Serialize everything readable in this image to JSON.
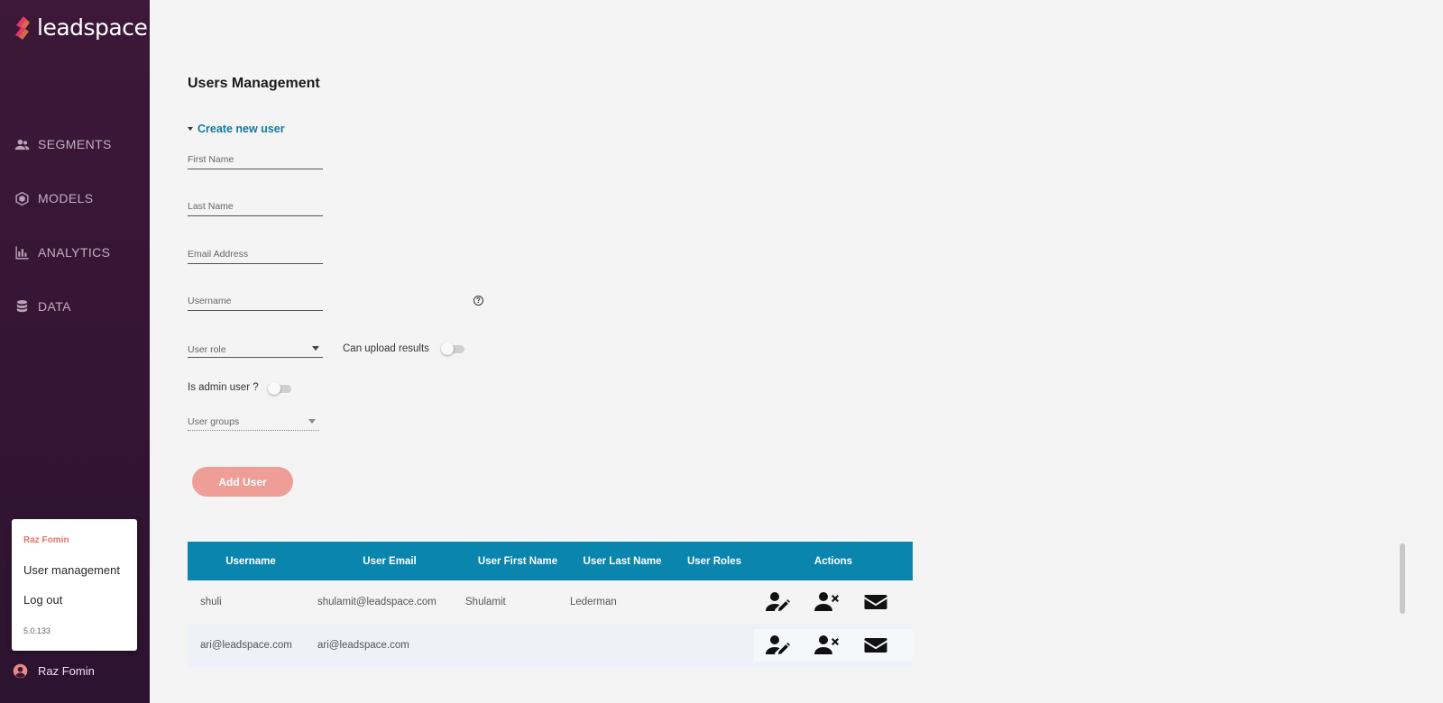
{
  "brand": {
    "name": "leadspace",
    "mark_colors": [
      "#e8346f",
      "#f07a46"
    ]
  },
  "sidebar": {
    "items": [
      {
        "label": "SEGMENTS",
        "icon": "people-icon"
      },
      {
        "label": "MODELS",
        "icon": "cube-icon"
      },
      {
        "label": "ANALYTICS",
        "icon": "bar-chart-icon"
      },
      {
        "label": "DATA",
        "icon": "database-icon"
      }
    ]
  },
  "user_menu": {
    "name": "Raz Fomin",
    "items": [
      "User management",
      "Log out"
    ],
    "version": "5.0.133"
  },
  "footer_user": {
    "name": "Raz Fomin",
    "icon": "account-circle-icon"
  },
  "page": {
    "title": "Users Management",
    "create_toggle": "Create new user",
    "fields": {
      "first_name": "First Name",
      "last_name": "Last Name",
      "email": "Email Address",
      "username": "Username",
      "user_role": "User role",
      "user_groups": "User groups"
    },
    "can_upload_label": "Can upload results",
    "is_admin_label": "Is admin user ?",
    "add_button": "Add User"
  },
  "table": {
    "headers": [
      "Username",
      "User Email",
      "User First Name",
      "User Last Name",
      "User Roles",
      "Actions"
    ],
    "rows": [
      {
        "username": "shuli",
        "email": "shulamit@leadspace.com",
        "first": "Shulamit",
        "last": "Lederman",
        "roles": ""
      },
      {
        "username": "ari@leadspace.com",
        "email": "ari@leadspace.com",
        "first": "",
        "last": "",
        "roles": ""
      }
    ]
  },
  "colors": {
    "sidebar_bg": "#3d1838",
    "accent_link": "#137a9c",
    "table_header": "#0a85ad",
    "add_button": "#ee9d97",
    "menu_name": "#e2766b"
  }
}
